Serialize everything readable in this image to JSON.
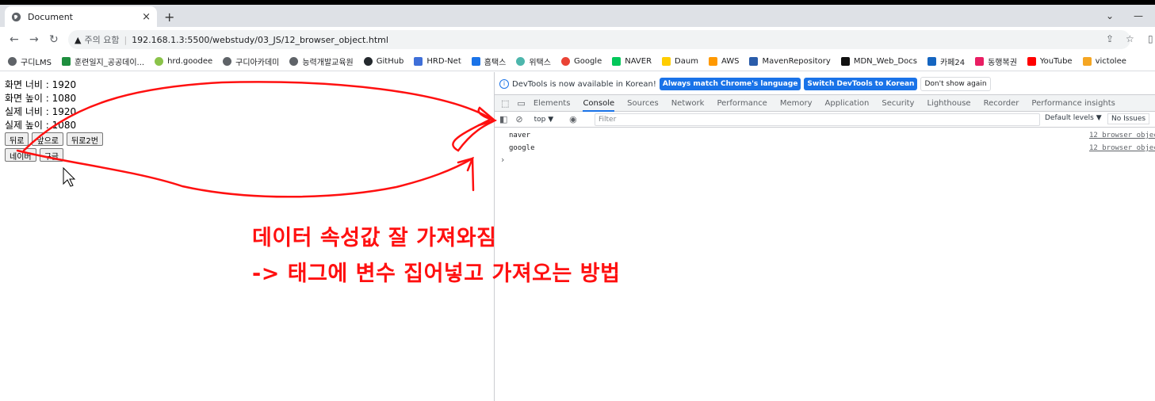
{
  "browser": {
    "tab_title": "Document",
    "tab_close": "×",
    "new_tab": "+",
    "window_min": "—",
    "window_chevron": "⌄",
    "security_label": "주의 요함",
    "url": "192.168.1.3:5500/webstudy/03_JS/12_browser_object.html",
    "bookmarks": [
      "구디LMS",
      "훈련일지_공공데이...",
      "hrd.goodee",
      "구디아카데미",
      "능력개발교육원",
      "GitHub",
      "HRD-Net",
      "홈택스",
      "위택스",
      "Google",
      "NAVER",
      "Daum",
      "AWS",
      "MavenRepository",
      "MDN_Web_Docs",
      "카페24",
      "동행복권",
      "YouTube",
      "victolee"
    ]
  },
  "page": {
    "lines": [
      "화면 너비 : 1920",
      "화면 높이 : 1080",
      "실제 너비 : 1920",
      "실제 높이 : 1080"
    ],
    "buttons_row1": [
      "뒤로",
      "앞으로",
      "뒤로2번"
    ],
    "buttons_row2": [
      "네이버",
      "구글"
    ]
  },
  "devtools": {
    "info_text": "DevTools is now available in Korean!",
    "btn_match": "Always match Chrome's language",
    "btn_switch": "Switch DevTools to Korean",
    "btn_dont_show": "Don't show again",
    "tabs": [
      "Elements",
      "Console",
      "Sources",
      "Network",
      "Performance",
      "Memory",
      "Application",
      "Security",
      "Lighthouse",
      "Recorder",
      "Performance insights"
    ],
    "context": "top ▼",
    "filter_placeholder": "Filter",
    "levels": "Default levels ▼",
    "issues": "No Issues",
    "logs": [
      "naver",
      "google"
    ],
    "log_source": "12_browser_objec",
    "prompt": "›"
  },
  "annotation": {
    "line1": "데이터 속성값 잘 가져와짐",
    "line2": "-> 태그에 변수 집어넣고 가져오는 방법",
    "color": "#ff1010"
  }
}
